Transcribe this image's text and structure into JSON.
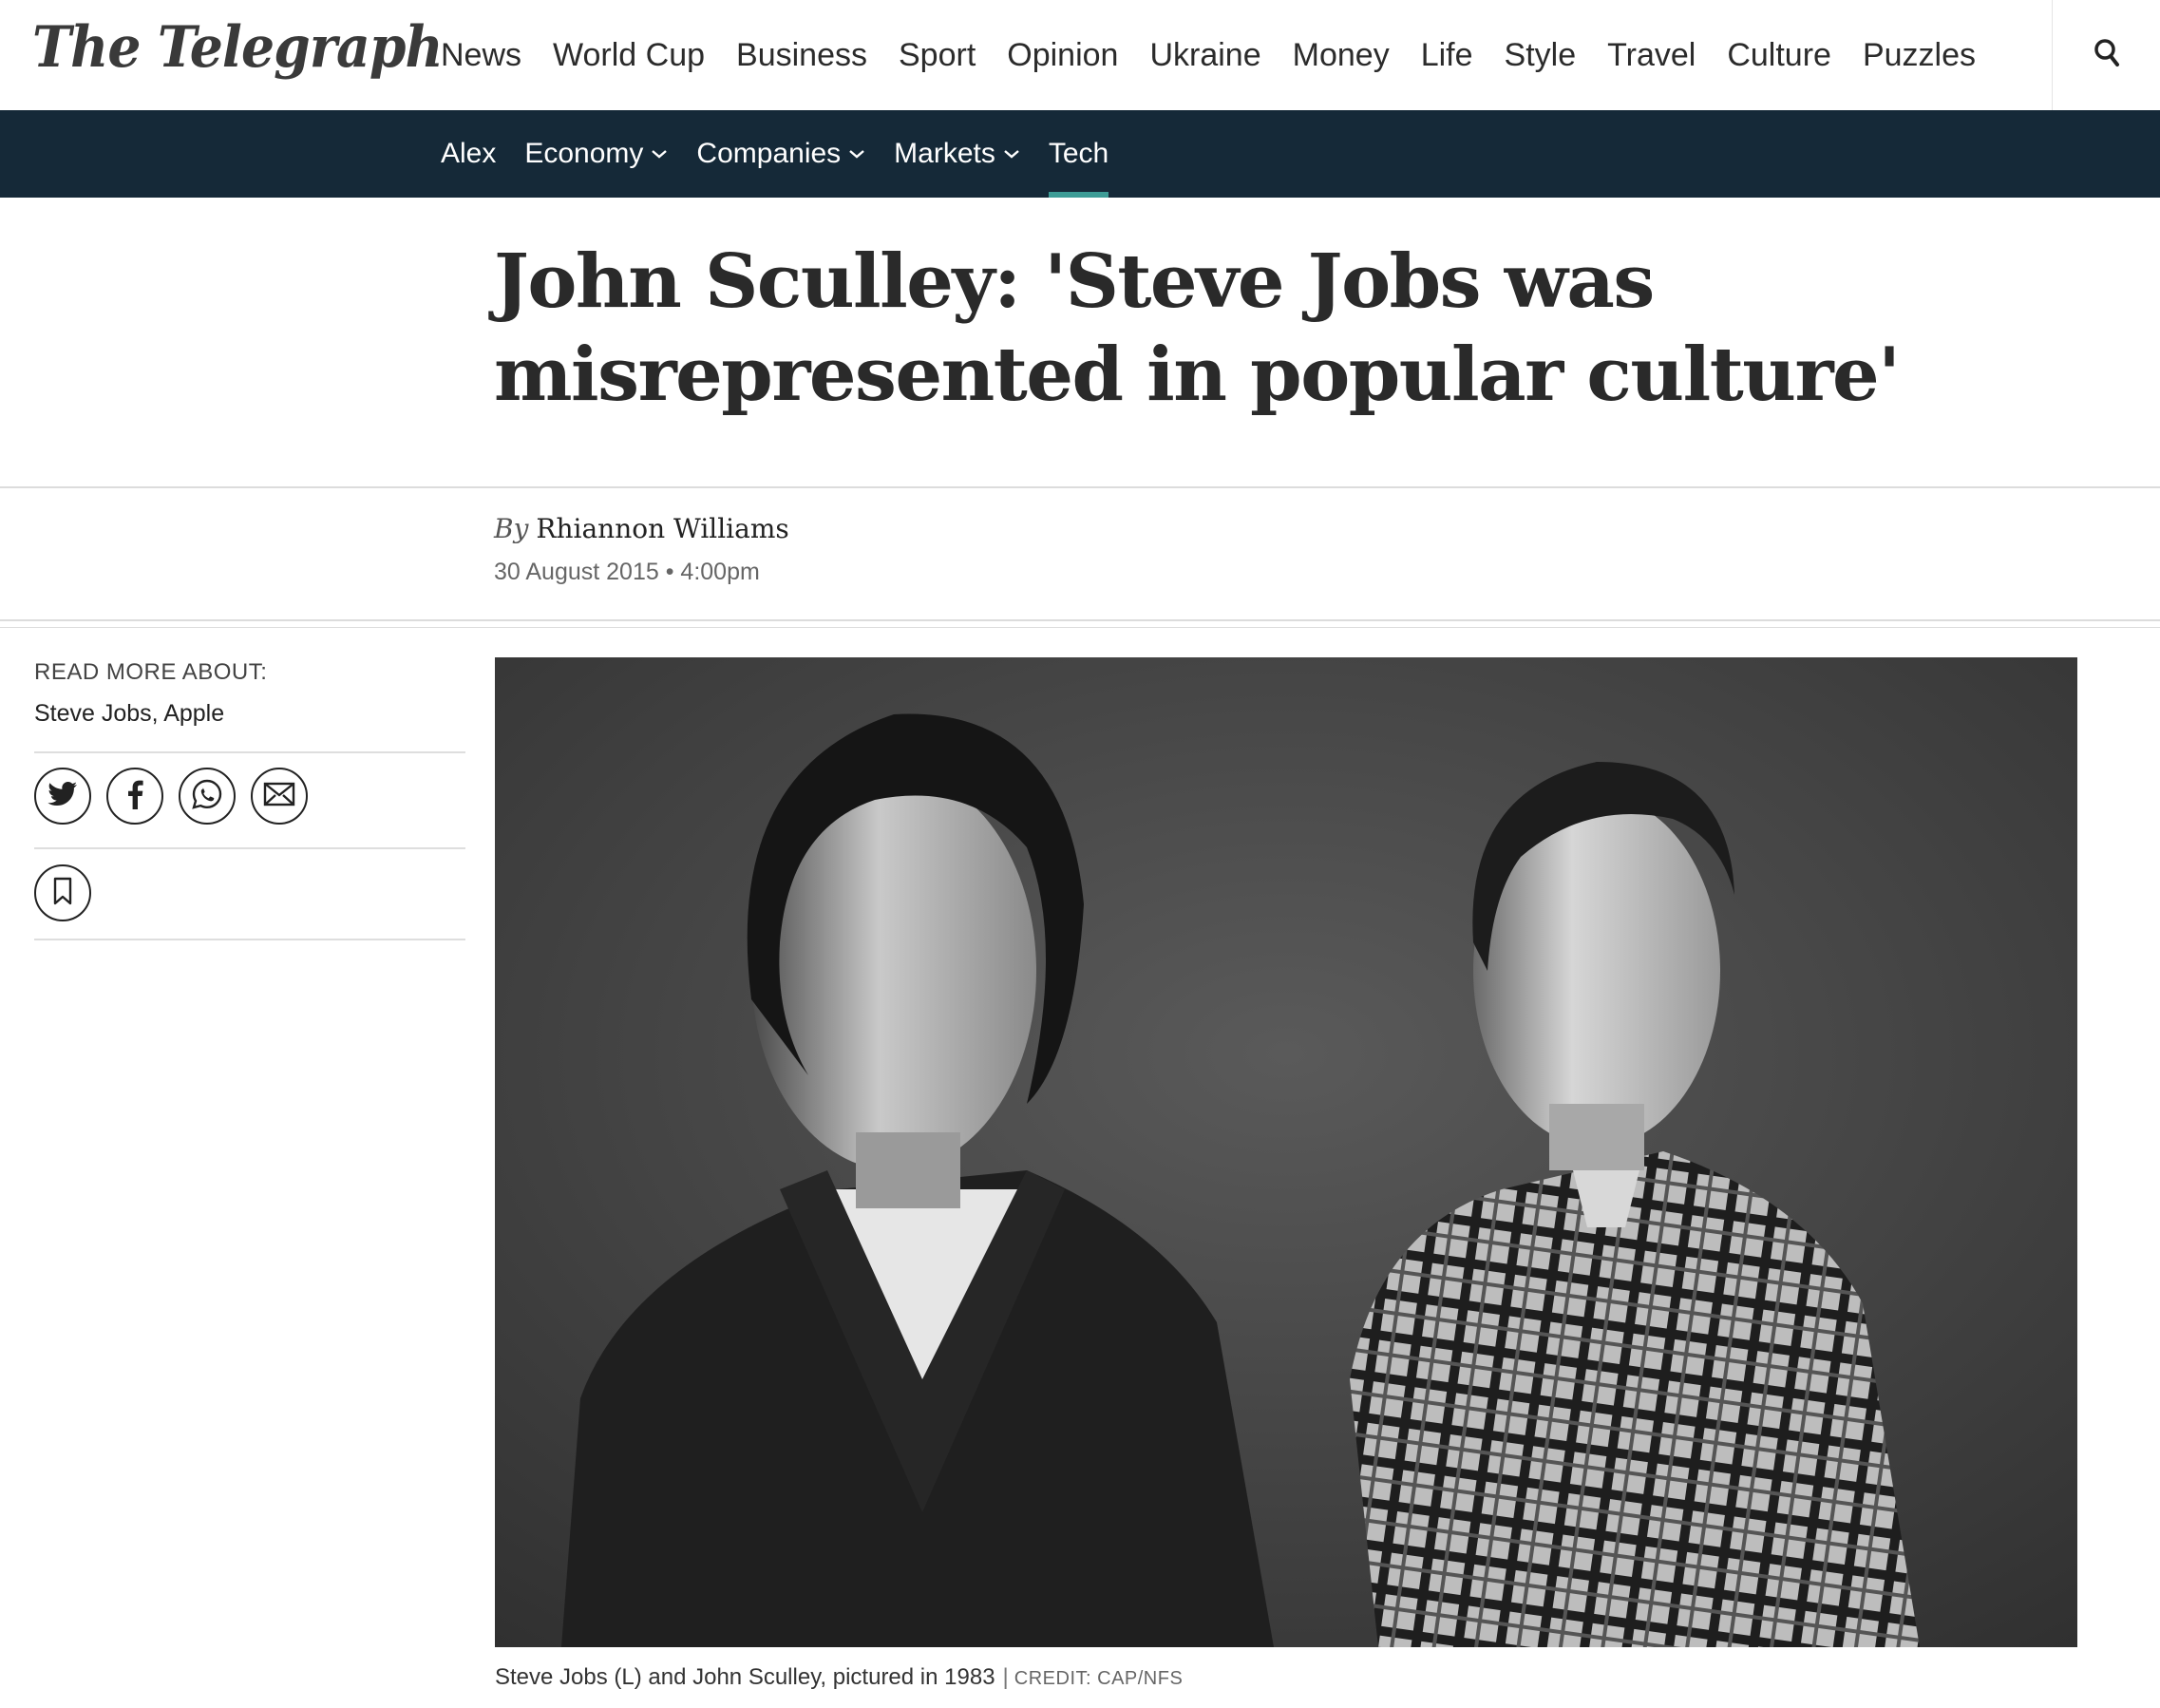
{
  "brand": {
    "logo_text": "The Telegraph"
  },
  "main_nav": {
    "items": [
      "News",
      "World Cup",
      "Business",
      "Sport",
      "Opinion",
      "Ukraine",
      "Money",
      "Life",
      "Style",
      "Travel",
      "Culture",
      "Puzzles"
    ],
    "active": "Business",
    "search_icon": "search-icon"
  },
  "sub_nav": {
    "items": [
      {
        "label": "Alex",
        "dropdown": false
      },
      {
        "label": "Economy",
        "dropdown": true
      },
      {
        "label": "Companies",
        "dropdown": true
      },
      {
        "label": "Markets",
        "dropdown": true
      },
      {
        "label": "Tech",
        "dropdown": false
      }
    ],
    "active": "Tech"
  },
  "article": {
    "headline": "John Sculley: 'Steve Jobs was misrepresented in popular culture'",
    "by_prefix": "By",
    "author": "Rhiannon Williams",
    "date": "30 August 2015 • 4:00pm"
  },
  "rail": {
    "read_more_label": "READ MORE ABOUT:",
    "topics": "Steve Jobs, Apple",
    "share_icons": [
      "twitter-icon",
      "facebook-icon",
      "whatsapp-icon",
      "email-icon"
    ],
    "bookmark_icon": "bookmark-icon"
  },
  "photo": {
    "caption": "Steve Jobs (L) and John Sculley, pictured in 1983",
    "separator": "|",
    "credit": "CREDIT: CAP/NFS"
  },
  "colors": {
    "accent": "#3d9c96",
    "subnav_bg": "#152938",
    "text": "#2a2a2a"
  }
}
